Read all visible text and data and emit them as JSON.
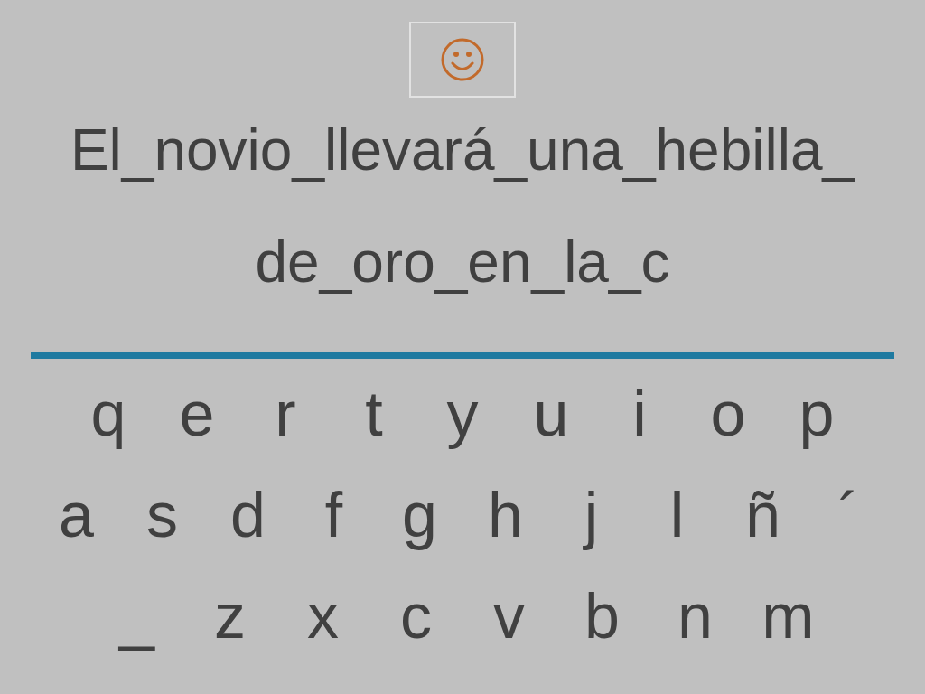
{
  "sentence": {
    "lines": [
      "El_novio_llevará_una_hebilla_",
      "de_oro_en_la_c"
    ]
  },
  "keyboard": {
    "rows": [
      [
        "q",
        "e",
        "r",
        "t",
        "y",
        "u",
        "i",
        "o",
        "p"
      ],
      [
        "a",
        "s",
        "d",
        "f",
        "g",
        "h",
        "j",
        "l",
        "ñ",
        "´"
      ],
      [
        "_",
        "z",
        "x",
        "c",
        "v",
        "b",
        "n",
        "m"
      ]
    ]
  }
}
